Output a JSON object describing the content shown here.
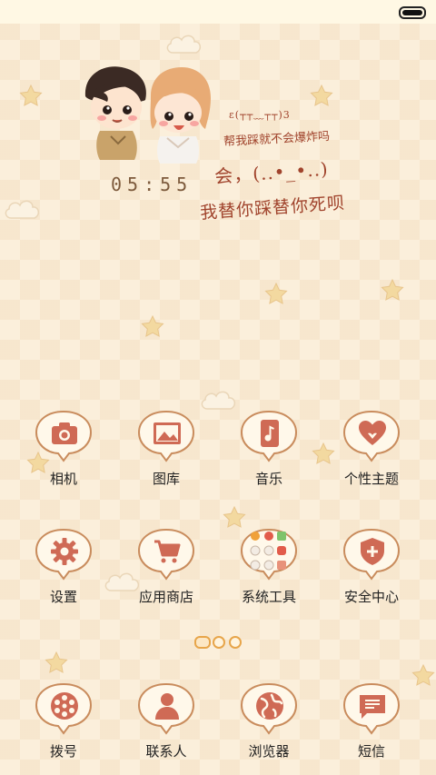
{
  "status_bar": {
    "battery_icon": "battery-icon"
  },
  "wallpaper": {
    "clock": "05:55",
    "handwriting": {
      "line1": "ε(┬┬﹏┬┬)3",
      "line2": "帮我踩就不会爆炸吗",
      "line3": "会，(..•_•..)",
      "line4": "我替你踩替你死呗"
    }
  },
  "colors": {
    "bubble_fill": "#fff8ea",
    "bubble_stroke": "#c98c5d",
    "icon": "#cf6a55",
    "text": "#222222"
  },
  "apps_page": [
    {
      "label": "相机",
      "icon": "camera-icon"
    },
    {
      "label": "图库",
      "icon": "gallery-icon"
    },
    {
      "label": "音乐",
      "icon": "music-icon"
    },
    {
      "label": "个性主题",
      "icon": "themes-heart-icon"
    },
    {
      "label": "设置",
      "icon": "settings-gear-icon"
    },
    {
      "label": "应用商店",
      "icon": "shopping-cart-icon"
    },
    {
      "label": "系统工具",
      "icon": "folder-icon"
    },
    {
      "label": "安全中心",
      "icon": "shield-plus-icon"
    }
  ],
  "page_indicator": {
    "count": 3,
    "active": 0
  },
  "dock": [
    {
      "label": "拨号",
      "icon": "phone-dial-icon"
    },
    {
      "label": "联系人",
      "icon": "contacts-person-icon"
    },
    {
      "label": "浏览器",
      "icon": "browser-globe-icon"
    },
    {
      "label": "短信",
      "icon": "sms-message-icon"
    }
  ]
}
